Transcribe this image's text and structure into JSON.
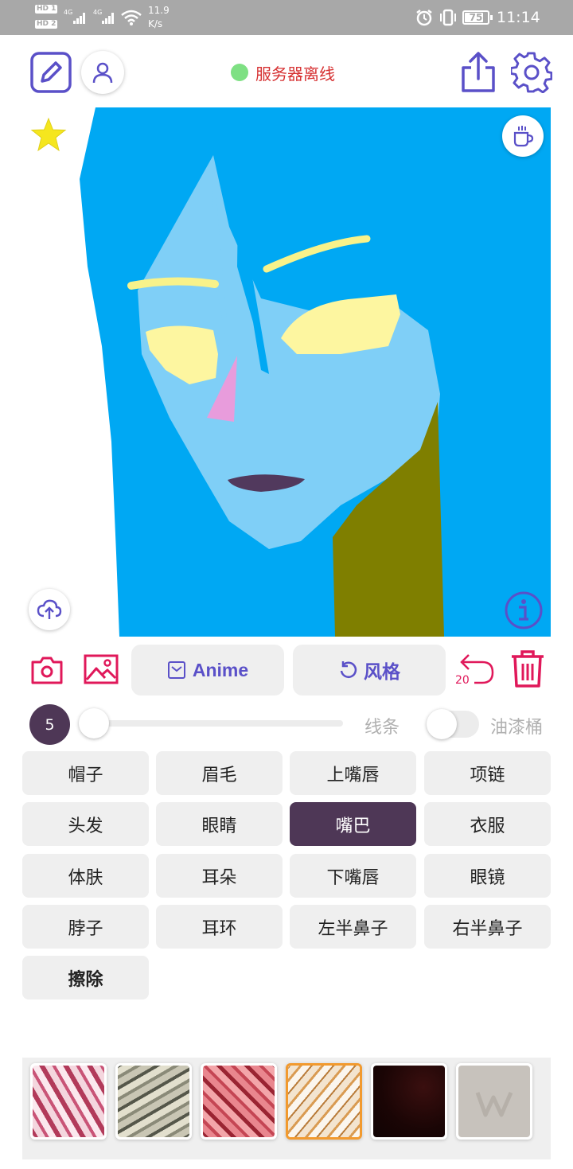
{
  "status_bar": {
    "sim1": "HD 1",
    "sim2": "HD 2",
    "net1": "4G",
    "net2": "4G",
    "speed_value": "11.9",
    "speed_unit": "K/s",
    "battery": "75",
    "time": "11:14"
  },
  "toolbar": {
    "server_status": "服务器离线",
    "server_status_color": "#7ee083"
  },
  "canvas": {
    "background_color": "#00a8f3"
  },
  "tools": {
    "anime_label": "Anime",
    "style_label": "风格",
    "undo_count": "20"
  },
  "brush": {
    "size": "5",
    "line_label": "线条",
    "bucket_label": "油漆桶"
  },
  "parts": [
    {
      "label": "帽子"
    },
    {
      "label": "眉毛"
    },
    {
      "label": "上嘴唇"
    },
    {
      "label": "项链"
    },
    {
      "label": "头发"
    },
    {
      "label": "眼睛"
    },
    {
      "label": "嘴巴"
    },
    {
      "label": "衣服"
    },
    {
      "label": "体肤"
    },
    {
      "label": "耳朵"
    },
    {
      "label": "下嘴唇"
    },
    {
      "label": "眼镜"
    },
    {
      "label": "脖子"
    },
    {
      "label": "耳环"
    },
    {
      "label": "左半鼻子"
    },
    {
      "label": "右半鼻子"
    },
    {
      "label": "擦除"
    }
  ],
  "selected_part": "嘴巴",
  "textures": [
    {
      "name": "pink-marble",
      "selected": false
    },
    {
      "name": "grey-marble",
      "selected": false
    },
    {
      "name": "red-marble",
      "selected": false
    },
    {
      "name": "gold-marble",
      "selected": true
    },
    {
      "name": "dark-red",
      "selected": false
    },
    {
      "name": "watermark-grey",
      "selected": false
    }
  ],
  "colors": {
    "accent": "#5a50c8",
    "danger": "#e0185a",
    "selected_part_bg": "#4e3756",
    "selected_texture_border": "#f29a2e"
  }
}
